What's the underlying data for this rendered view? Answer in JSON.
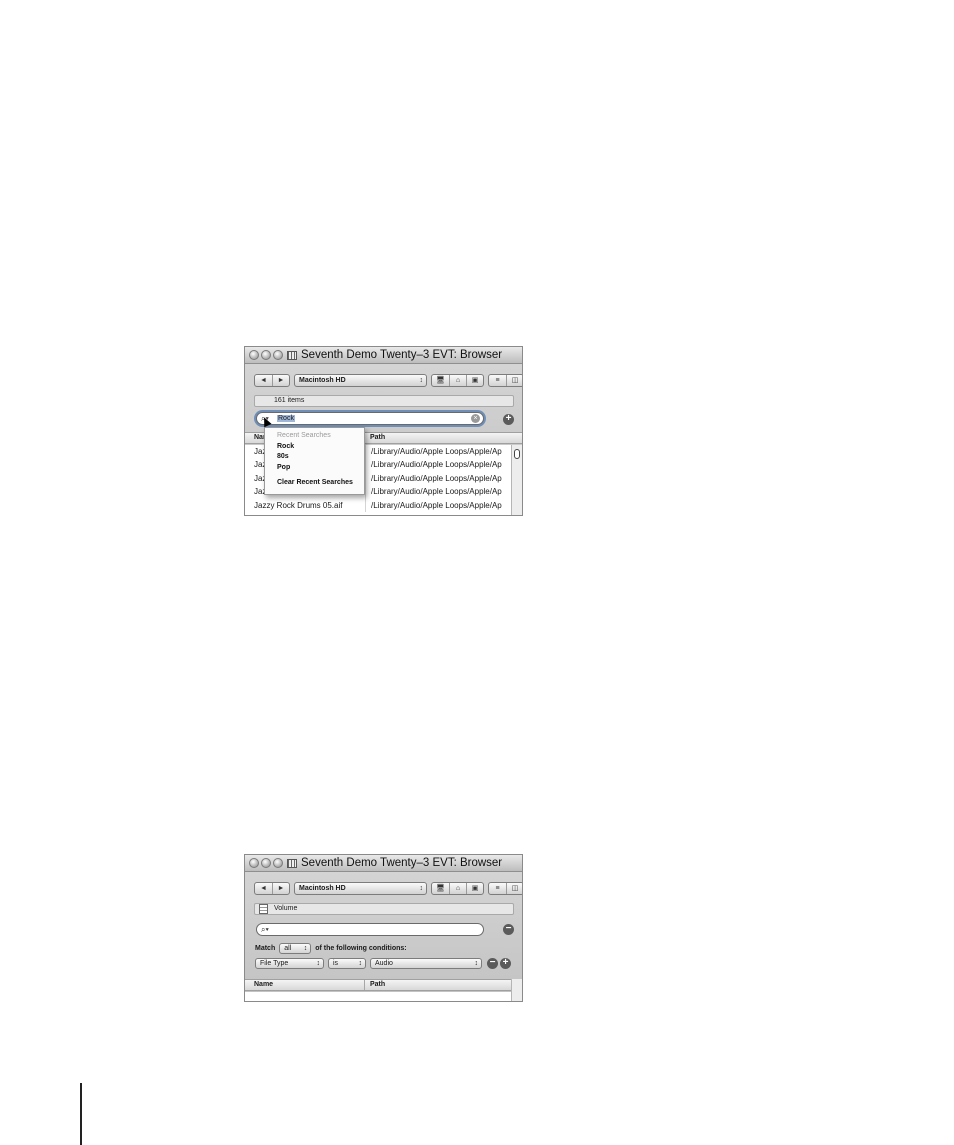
{
  "browser1": {
    "title": "Seventh Demo Twenty–3 EVT: Browser",
    "toolbar": {
      "back": "◄",
      "forward": "►",
      "disk": "Macintosh HD",
      "disk_arrows": "↕",
      "computer": "🖥",
      "home": "⌂",
      "project": "▣",
      "list_view": "≡",
      "column_view": "◫"
    },
    "info": "161 items",
    "search": {
      "icon": "⌕▾",
      "value": "Rock",
      "clear": "×"
    },
    "add": "+",
    "columns": {
      "name": "Name",
      "path": "Path"
    },
    "rows": [
      {
        "name": "Jazz",
        "path": "/Library/Audio/Apple Loops/Apple/Ap"
      },
      {
        "name": "Jazz",
        "path": "/Library/Audio/Apple Loops/Apple/Ap"
      },
      {
        "name": "Jazz",
        "path": "/Library/Audio/Apple Loops/Apple/Ap"
      },
      {
        "name": "Jazz",
        "path": "/Library/Audio/Apple Loops/Apple/Ap"
      },
      {
        "name": "Jazzy Rock Drums 05.aif",
        "path": "/Library/Audio/Apple Loops/Apple/Ap"
      }
    ],
    "recent": {
      "header": "Recent Searches",
      "items": [
        "Rock",
        "80s",
        "Pop"
      ],
      "clear": "Clear Recent Searches"
    }
  },
  "browser2": {
    "title": "Seventh Demo Twenty–3 EVT: Browser",
    "toolbar": {
      "back": "◄",
      "forward": "►",
      "disk": "Macintosh HD",
      "disk_arrows": "↕",
      "computer": "🖥",
      "home": "⌂",
      "project": "▣",
      "list_view": "≡",
      "column_view": "◫"
    },
    "info": "Volume",
    "search": {
      "icon": "⌕▾",
      "value": ""
    },
    "remove": "−",
    "match_label": "Match",
    "match_value": "all",
    "match_suffix": "of the following conditions:",
    "condition": {
      "field": "File Type",
      "operator": "is",
      "value": "Audio"
    },
    "cond_remove": "−",
    "cond_add": "+",
    "columns": {
      "name": "Name",
      "path": "Path"
    }
  }
}
